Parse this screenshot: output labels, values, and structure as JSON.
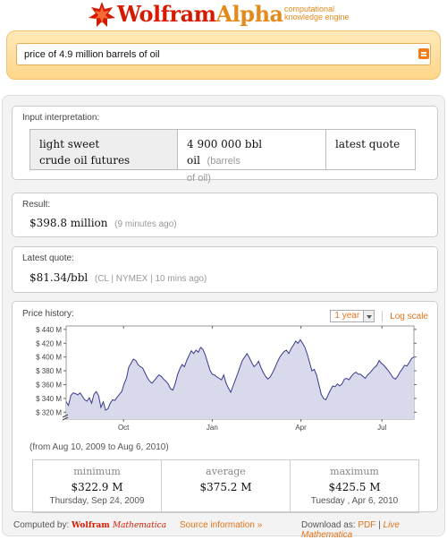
{
  "header": {
    "logo_wolfram": "Wolfram",
    "logo_alpha": "Alpha",
    "tagline_1": "computational",
    "tagline_2": "knowledge engine"
  },
  "search": {
    "query": "price of 4.9 million barrels of oil"
  },
  "interpretation": {
    "title": "Input interpretation:",
    "commodity_1": "light sweet",
    "commodity_2": "crude oil futures",
    "amount": "4 900 000 bbl oil",
    "amount_unit_1": "(barrels",
    "amount_unit_2": "of oil)",
    "quote_type": "latest quote"
  },
  "result": {
    "title": "Result:",
    "value": "$398.8 million",
    "age": "(9 minutes ago)"
  },
  "latest_quote": {
    "title": "Latest quote:",
    "value": "$81.34/bbl",
    "details": "(CL | NYMEX | 10 mins ago)"
  },
  "price_history": {
    "title": "Price history:",
    "range_selected": "1 year",
    "log_scale_label": "Log scale",
    "date_range": "(from Aug 10, 2009 to Aug 6, 2010)",
    "stats": [
      {
        "label": "minimum",
        "value": "$322.9 M",
        "date": "Thursday, Sep 24, 2009"
      },
      {
        "label": "average",
        "value": "$375.2 M",
        "date": ""
      },
      {
        "label": "maximum",
        "value": "$425.5 M",
        "date": "Tuesday , Apr 6, 2010"
      }
    ]
  },
  "chart_data": {
    "type": "line",
    "title": "",
    "xlabel": "",
    "ylabel": "",
    "x_ticks": [
      "Oct",
      "Jan",
      "Apr",
      "Jul"
    ],
    "y_ticks": [
      "$ 320 M",
      "$ 340 M",
      "$ 360 M",
      "$ 380 M",
      "$ 400 M",
      "$ 420 M",
      "$ 440 M"
    ],
    "ylim": [
      310,
      445
    ],
    "series": [
      {
        "values": [
          335,
          330,
          344,
          348,
          347,
          345,
          348,
          343,
          338,
          336,
          341,
          333,
          346,
          350,
          344,
          327,
          335,
          323,
          325,
          333,
          338,
          337,
          342,
          346,
          350,
          361,
          369,
          385,
          391,
          397,
          395,
          389,
          386,
          384,
          377,
          370,
          365,
          362,
          366,
          370,
          374,
          372,
          368,
          365,
          361,
          354,
          352,
          361,
          374,
          383,
          389,
          386,
          395,
          402,
          409,
          405,
          410,
          407,
          414,
          411,
          403,
          392,
          381,
          375,
          374,
          371,
          369,
          367,
          374,
          362,
          355,
          349,
          358,
          367,
          376,
          386,
          395,
          400,
          405,
          399,
          392,
          386,
          389,
          394,
          385,
          378,
          372,
          368,
          371,
          377,
          384,
          392,
          399,
          404,
          408,
          410,
          405,
          412,
          417,
          423,
          420,
          425,
          420,
          414,
          404,
          392,
          380,
          382,
          374,
          360,
          346,
          340,
          338,
          345,
          352,
          358,
          357,
          361,
          358,
          361,
          368,
          369,
          367,
          372,
          376,
          378,
          375,
          375,
          372,
          369,
          374,
          377,
          381,
          385,
          388,
          395,
          391,
          388,
          384,
          380,
          375,
          370,
          368,
          372,
          378,
          383,
          388,
          387,
          392,
          398,
          400
        ]
      }
    ],
    "line_color": "#3a3a8a",
    "fill_color": "#d9d9ec",
    "grid": true
  },
  "footer": {
    "computed_by": "Computed by:",
    "brand_wolfram": "Wolfram",
    "brand_mathematica": "Mathematica",
    "source_info": "Source information »",
    "download_as": "Download as:",
    "pdf": "PDF",
    "separator": "|",
    "live_mathematica": "Live Mathematica"
  }
}
